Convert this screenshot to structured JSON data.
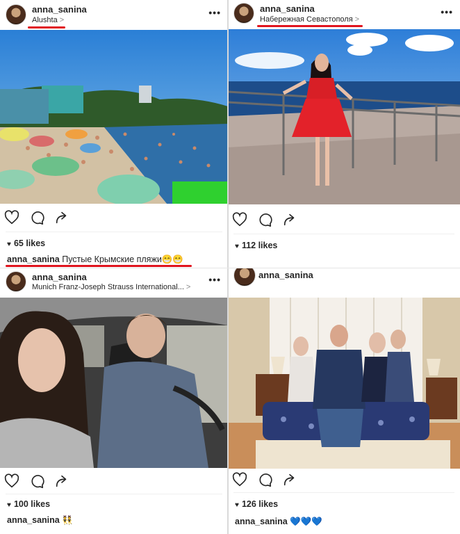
{
  "posts": [
    {
      "username": "anna_sanina",
      "location": "Alushta",
      "more": "•••",
      "likes": "65 likes",
      "caption_user": "anna_sanina",
      "caption_text": " Пустые Крымские пляжи😁😁"
    },
    {
      "username": "anna_sanina",
      "location": "Набережная Севастополя",
      "more": "•••",
      "likes": "112 likes",
      "caption_user": "",
      "caption_text": ""
    },
    {
      "username": "anna_sanina",
      "location": "Munich Franz-Joseph Strauss  International...",
      "more": "•••",
      "likes": "100 likes",
      "caption_user": "anna_sanina",
      "caption_text": " 👯"
    },
    {
      "username": "anna_sanina",
      "location": "",
      "more": "",
      "likes": "126 likes",
      "caption_user": "anna_sanina",
      "caption_text": " 💙💙💙"
    }
  ],
  "chevron": ">",
  "heart_glyph": "♥",
  "icons": [
    "heart-icon",
    "comment-icon",
    "share-icon"
  ],
  "colors": {
    "highlight_red": "#e0141e",
    "text": "#262626"
  }
}
